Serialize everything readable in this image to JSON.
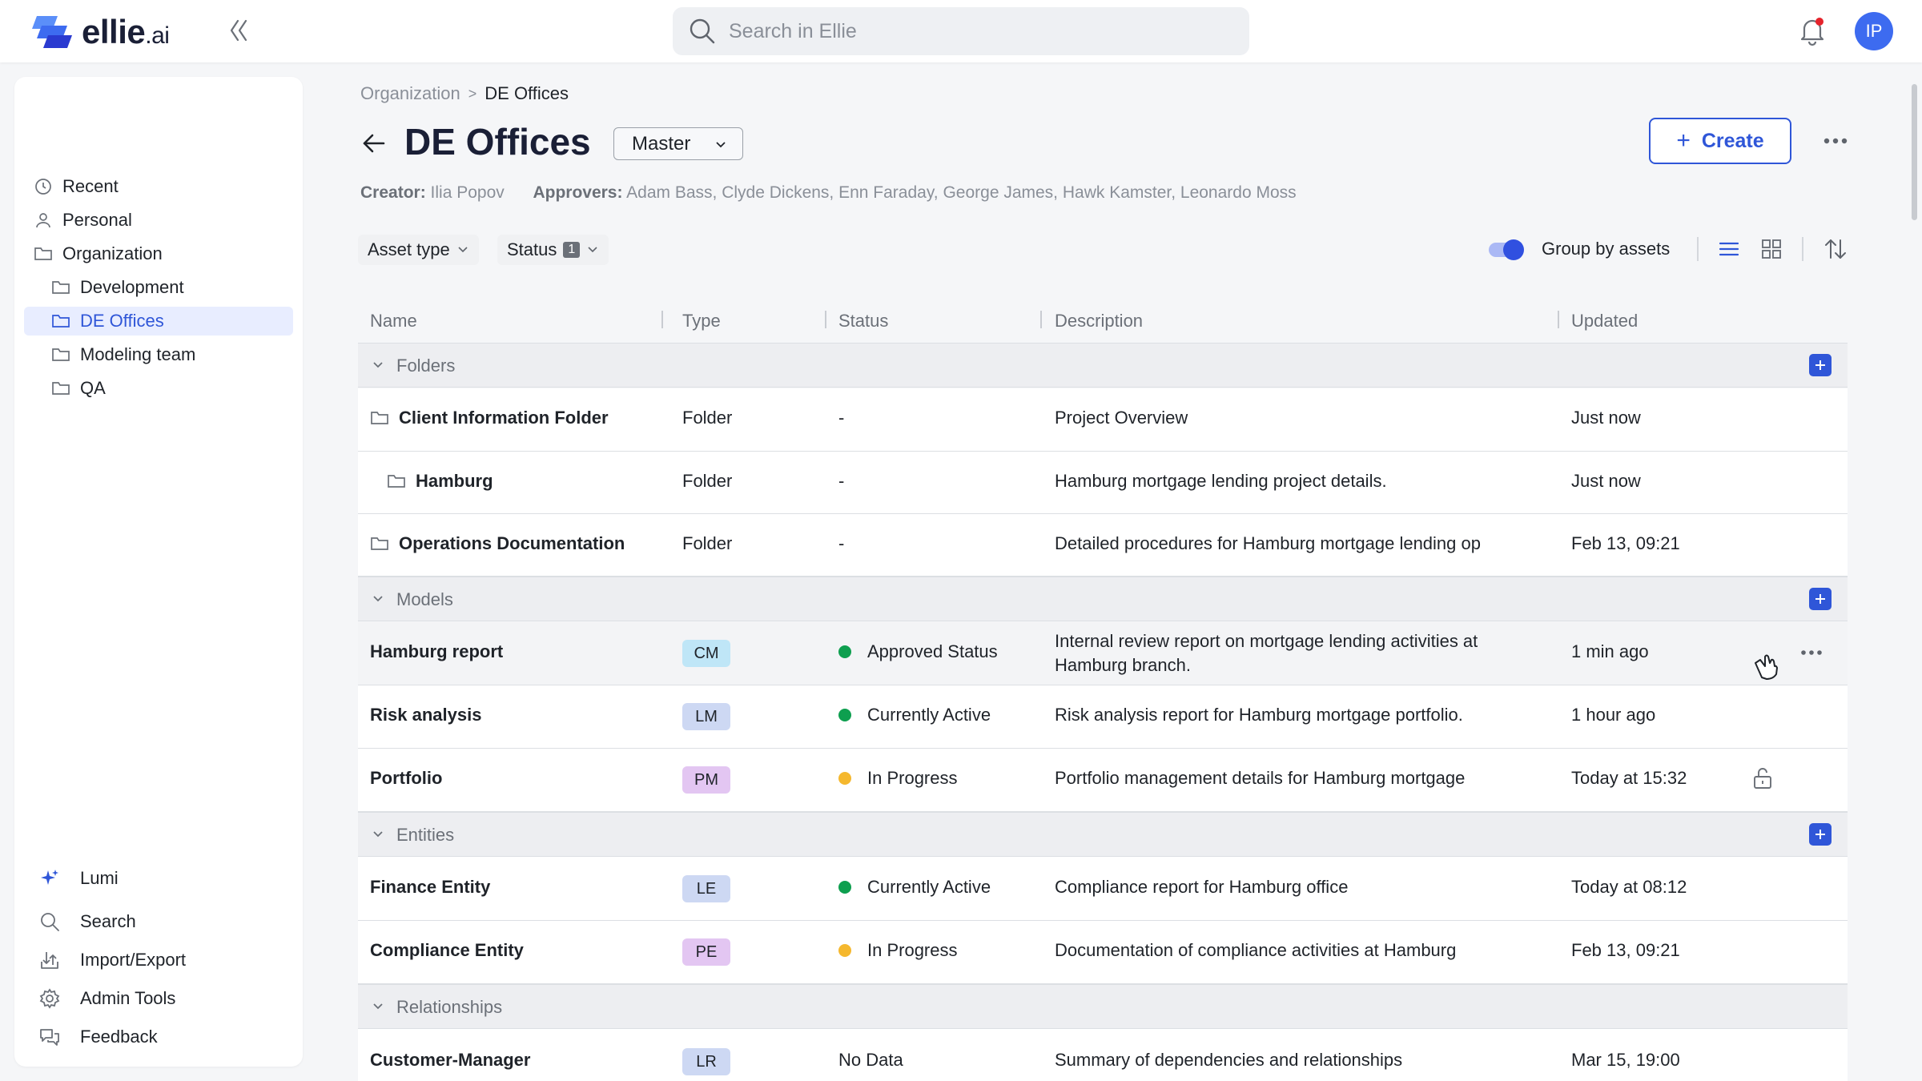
{
  "app": {
    "logo_main": "ellie",
    "logo_suffix": ".ai",
    "search_placeholder": "Search in Ellie",
    "user_initials": "IP",
    "accent_color": "#2f56d8"
  },
  "sidebar": {
    "items": [
      {
        "label": "Recent",
        "icon": "clock-icon"
      },
      {
        "label": "Personal",
        "icon": "user-icon"
      },
      {
        "label": "Organization",
        "icon": "folder-icon"
      },
      {
        "label": "Development",
        "icon": "folder-icon"
      },
      {
        "label": "DE Offices",
        "icon": "folder-icon",
        "active": true
      },
      {
        "label": "Modeling team",
        "icon": "folder-icon"
      },
      {
        "label": "QA",
        "icon": "folder-icon"
      }
    ],
    "bottom": [
      {
        "label": "Lumi",
        "icon": "sparkle-icon"
      },
      {
        "label": "Search",
        "icon": "search-icon"
      },
      {
        "label": "Import/Export",
        "icon": "import-export-icon"
      },
      {
        "label": "Admin Tools",
        "icon": "gear-icon"
      },
      {
        "label": "Feedback",
        "icon": "feedback-icon"
      }
    ]
  },
  "breadcrumb": {
    "root": "Organization",
    "sep": ">",
    "current": "DE Offices"
  },
  "page": {
    "title": "DE Offices",
    "branch": "Master",
    "create_label": "Create",
    "creator_label": "Creator:",
    "creator": "Ilia Popov",
    "approvers_label": "Approvers:",
    "approvers": "Adam Bass, Clyde Dickens, Enn Faraday, George James, Hawk Kamster, Leonardo Moss"
  },
  "filters": {
    "asset_type": "Asset type",
    "status": "Status",
    "status_count": "1",
    "group_by": "Group by assets",
    "group_by_enabled": true
  },
  "table": {
    "headers": {
      "name": "Name",
      "type": "Type",
      "status": "Status",
      "description": "Description",
      "updated": "Updated"
    },
    "groups": {
      "folders": "Folders",
      "models": "Models",
      "entities": "Entities",
      "relationships": "Relationships"
    },
    "folders": [
      {
        "name": "Client Information Folder",
        "type": "Folder",
        "status": "-",
        "description": "Project Overview",
        "updated": "Just now"
      },
      {
        "name": "Hamburg",
        "type": "Folder",
        "status": "-",
        "description": "Hamburg mortgage lending project details.",
        "updated": "Just now"
      },
      {
        "name": "Operations Documentation",
        "type": "Folder",
        "status": "-",
        "description": "Detailed procedures for Hamburg mortgage lending op",
        "updated": "Feb 13, 09:21"
      }
    ],
    "models": [
      {
        "name": "Hamburg report",
        "type": "CM",
        "status": "Approved Status",
        "status_color": "#0e9f4f",
        "description": "Internal review report on mortgage lending activities at Hamburg branch.",
        "updated": "1 min ago",
        "chip_color": "#bfe6f7"
      },
      {
        "name": "Risk analysis",
        "type": "LM",
        "status": "Currently Active",
        "status_color": "#0e9f4f",
        "description": "Risk analysis report for Hamburg mortgage portfolio.",
        "updated": "1 hour ago",
        "chip_color": "#cdd8f3"
      },
      {
        "name": "Portfolio",
        "type": "PM",
        "status": "In Progress",
        "status_color": "#f5b82e",
        "description": "Portfolio management details for Hamburg mortgage",
        "updated": "Today at 15:32",
        "chip_color": "#e3c6f2"
      }
    ],
    "entities": [
      {
        "name": "Finance Entity",
        "type": "LE",
        "status": "Currently Active",
        "status_color": "#0e9f4f",
        "description": "Compliance report for Hamburg office",
        "updated": "Today at 08:12",
        "chip_color": "#cdd8f3"
      },
      {
        "name": "Compliance Entity",
        "type": "PE",
        "status": "In Progress",
        "status_color": "#f5b82e",
        "description": "Documentation of compliance activities at Hamburg",
        "updated": "Feb 13, 09:21",
        "chip_color": "#e3c6f2"
      }
    ],
    "relationships": [
      {
        "name": "Customer-Manager",
        "type": "LR",
        "status": "No Data",
        "description": "Summary of dependencies and relationships",
        "updated": "Mar 15, 19:00",
        "chip_color": "#cdd8f3"
      }
    ]
  }
}
